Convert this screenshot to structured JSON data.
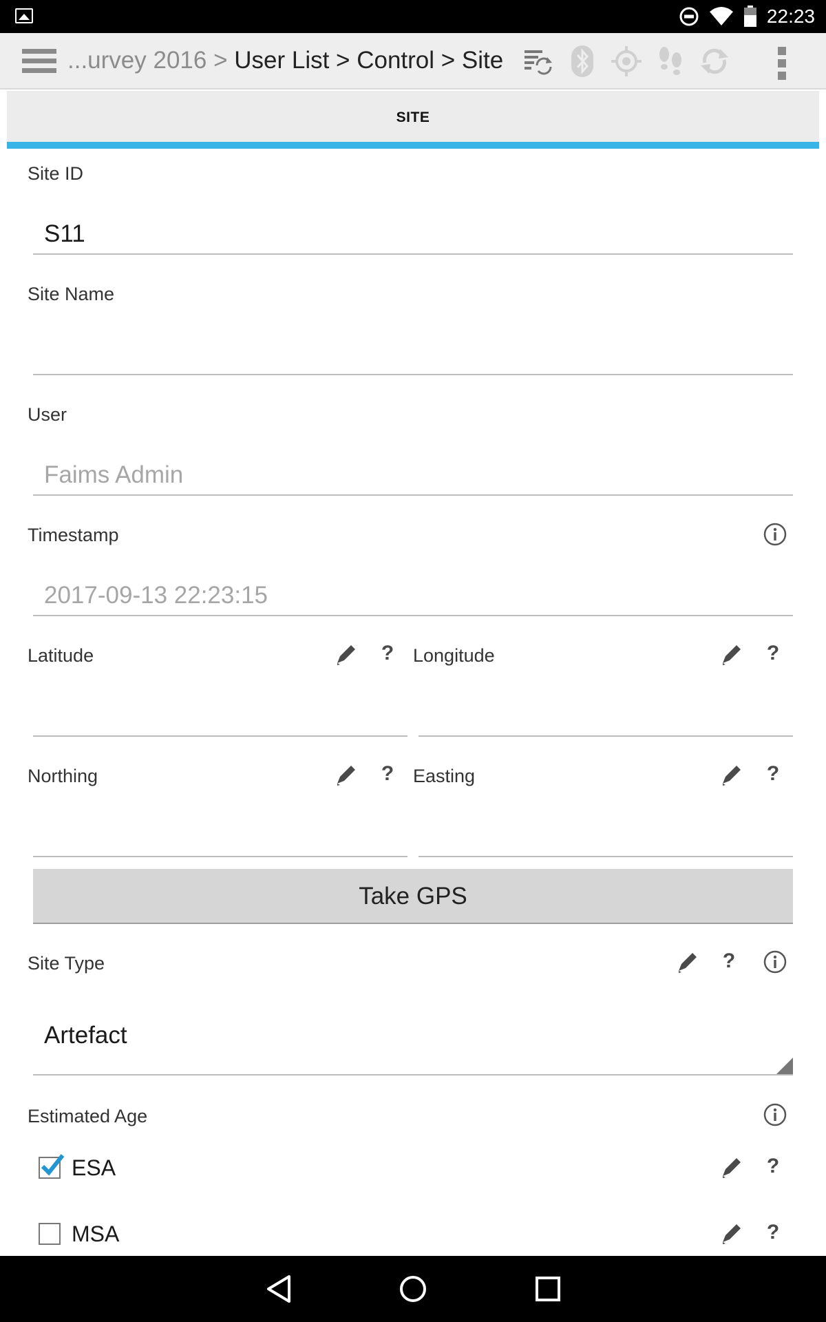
{
  "status_bar": {
    "time": "22:23"
  },
  "app_bar": {
    "breadcrumb_dim": "...urvey 2016 > ",
    "breadcrumb_rest": "User List > Control > Site"
  },
  "tab": {
    "label": "SITE"
  },
  "form": {
    "site_id": {
      "label": "Site ID",
      "value": "S11"
    },
    "site_name": {
      "label": "Site Name",
      "value": ""
    },
    "user": {
      "label": "User",
      "value": "Faims Admin"
    },
    "timestamp": {
      "label": "Timestamp",
      "value": "2017-09-13 22:23:15"
    },
    "latitude": {
      "label": "Latitude",
      "value": ""
    },
    "longitude": {
      "label": "Longitude",
      "value": ""
    },
    "northing": {
      "label": "Northing",
      "value": ""
    },
    "easting": {
      "label": "Easting",
      "value": ""
    },
    "take_gps": {
      "label": "Take GPS"
    },
    "site_type": {
      "label": "Site Type",
      "value": "Artefact"
    },
    "estimated_age": {
      "label": "Estimated Age",
      "options": [
        {
          "label": "ESA",
          "checked": true
        },
        {
          "label": "MSA",
          "checked": false
        }
      ]
    }
  },
  "help_symbol": "?",
  "colors": {
    "accent": "#38b4e6",
    "checkbox": "#2196d3"
  }
}
